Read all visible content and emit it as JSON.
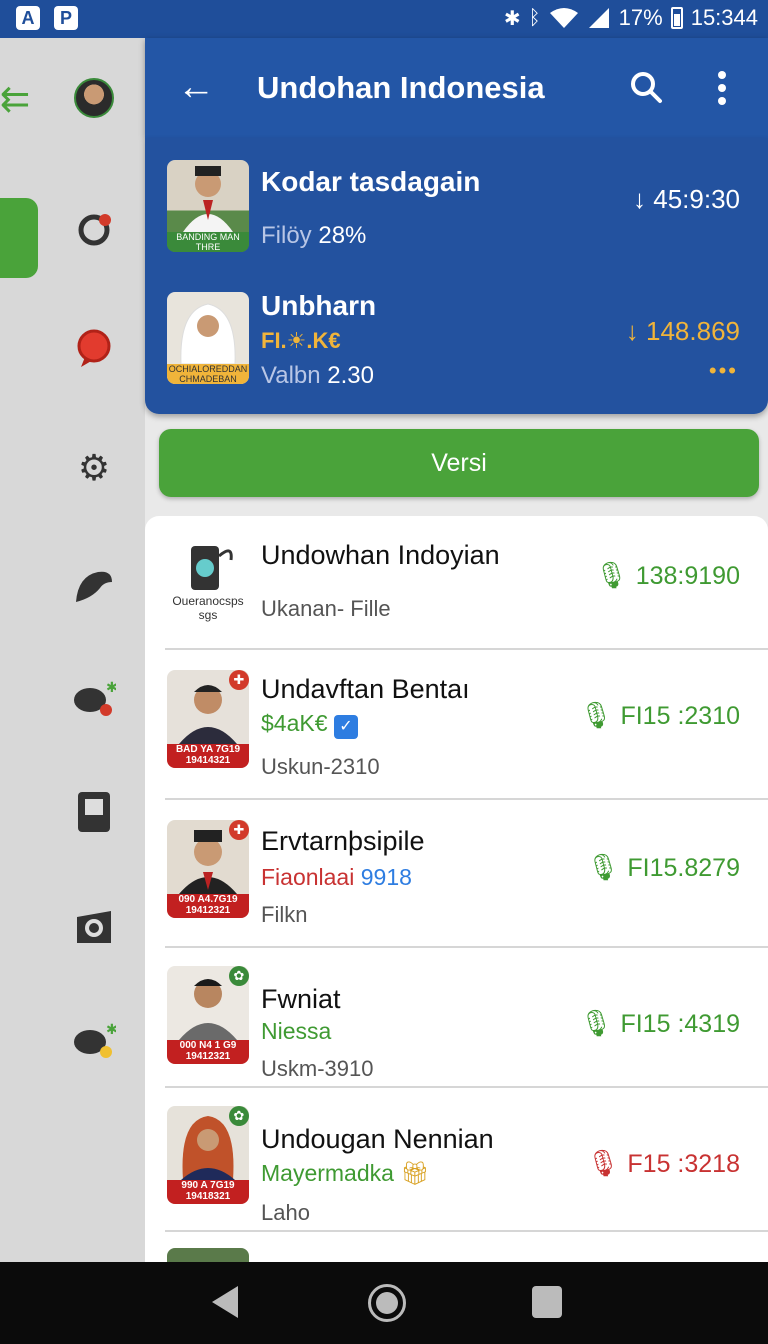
{
  "status_bar": {
    "left_icons": [
      "A",
      "P"
    ],
    "battery": "17%",
    "time": "15:344"
  },
  "app_bar": {
    "title": "Undohan Indonesia",
    "back_icon": "arrow-left-icon",
    "search_icon": "search-icon",
    "more_icon": "more-vert-icon"
  },
  "featured": [
    {
      "title": "Kodar tasdagain",
      "subtitle_muted": "Filöy",
      "subtitle_value": "28%",
      "value": "45:9:30",
      "thumb_text": "BANDING MAN THRE"
    },
    {
      "title": "Unbharn",
      "tag": "FI.☀.K€",
      "subtitle_muted": "Valbn",
      "subtitle_value": "2.30",
      "value": "148.869",
      "thumb_text": "OCHIALOREDDAN CHMADEBAN"
    }
  ],
  "versi_button": {
    "label": "Versi"
  },
  "list": [
    {
      "title": "Undowhan Indoyian",
      "meta": "Ukanan- Fille",
      "value": "138:9190",
      "thumb_caption": "Oueranocsps sgs"
    },
    {
      "title": "Undavftan Bentaı",
      "sub": "$4aK€",
      "meta": "Uskun-2310",
      "value": "FI15 :2310",
      "plate": "BAD YA 7G19 19414321"
    },
    {
      "title": "Ervtarnþsipile",
      "sub_red": "Fiaonlaai",
      "sub_blue": "9918",
      "meta": "Filkn",
      "value": "FI15.8279",
      "plate": "090 A4.7G19 19412321"
    },
    {
      "title": "Fwniat",
      "sub": "Niessa",
      "meta": "Uskm-3910",
      "value": "FI15 :4319",
      "plate": "000 N4 1 G9 19412321"
    },
    {
      "title": "Undougan Nennian",
      "sub": "Mayermadka",
      "meta": "Laho",
      "value": "F15 :3218",
      "plate": "990 A 7G19 19418321"
    }
  ],
  "colors": {
    "primary": "#2356a6",
    "accent_green": "#4aa33a",
    "value_orange": "#f0b43a",
    "value_red": "#c83232"
  }
}
